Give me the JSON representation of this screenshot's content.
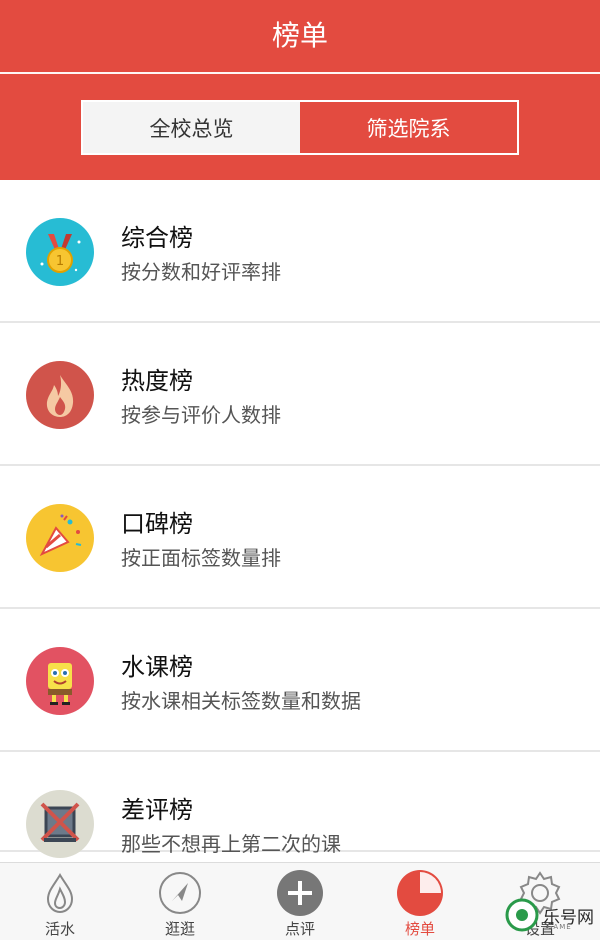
{
  "header": {
    "title": "榜单",
    "tabs": [
      {
        "label": "全校总览",
        "selected": false
      },
      {
        "label": "筛选院系",
        "selected": true
      }
    ]
  },
  "list": [
    {
      "title": "综合榜",
      "subtitle": "按分数和好评率排",
      "icon": "medal-icon",
      "color": "#27bcd4"
    },
    {
      "title": "热度榜",
      "subtitle": "按参与评价人数排",
      "icon": "flame-icon",
      "color": "#d0544b"
    },
    {
      "title": "口碑榜",
      "subtitle": "按正面标签数量排",
      "icon": "party-popper-icon",
      "color": "#f7c531"
    },
    {
      "title": "水课榜",
      "subtitle": "按水课相关标签数量和数据",
      "icon": "sponge-character-icon",
      "color": "#e25262"
    },
    {
      "title": "差评榜",
      "subtitle": "那些不想再上第二次的课",
      "icon": "crossed-box-icon",
      "color": "#dcdcd0"
    }
  ],
  "tabbar": [
    {
      "label": "活水",
      "icon": "drop-icon",
      "active": false
    },
    {
      "label": "逛逛",
      "icon": "compass-icon",
      "active": false
    },
    {
      "label": "点评",
      "icon": "plus-icon",
      "active": false
    },
    {
      "label": "榜单",
      "icon": "pie-chart-icon",
      "active": true
    },
    {
      "label": "设置",
      "icon": "gear-icon",
      "active": false
    }
  ],
  "watermark": {
    "text": "乐号网",
    "sub": "GAME"
  },
  "colors": {
    "accent": "#e34b40"
  }
}
